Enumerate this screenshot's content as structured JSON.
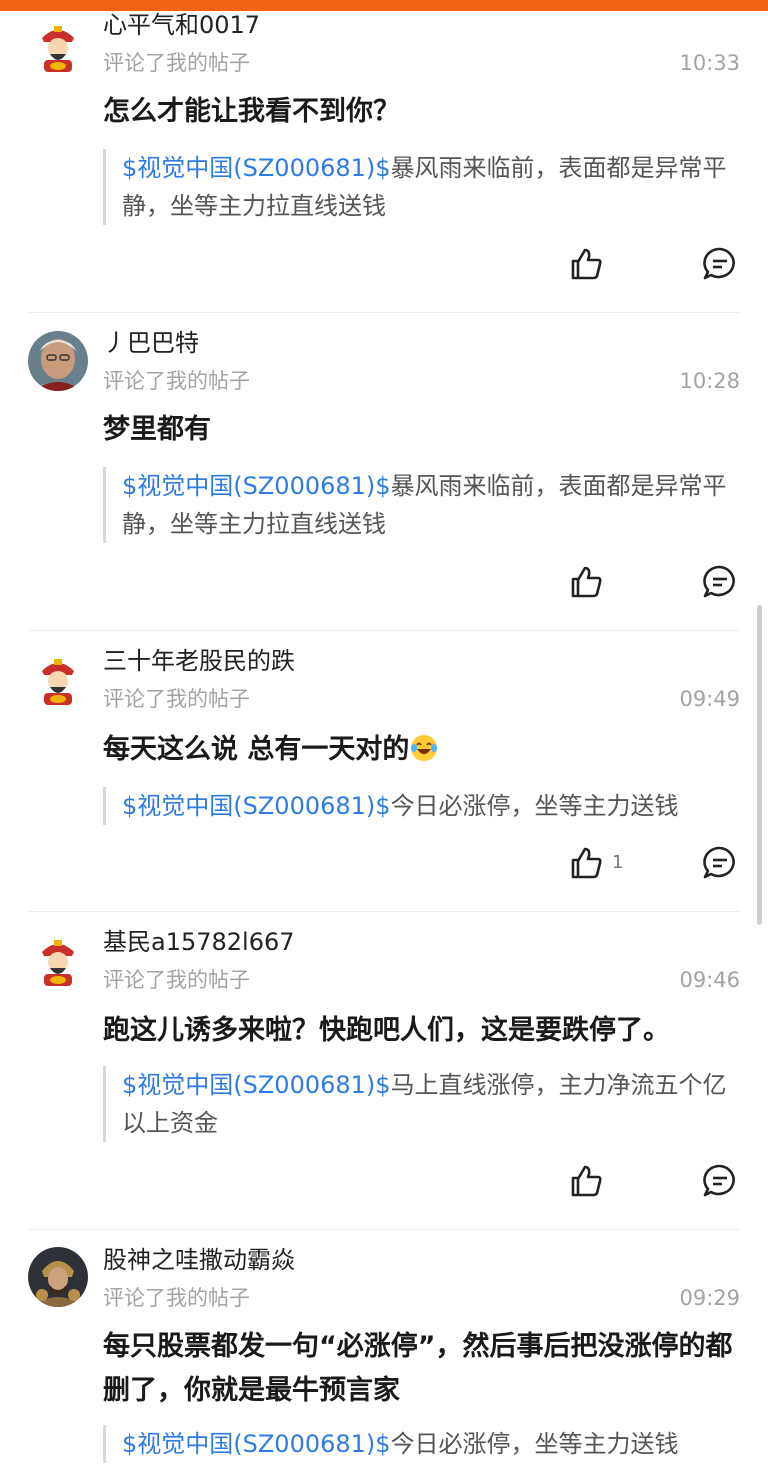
{
  "colors": {
    "accent": "#f26310",
    "link": "#2f7be5"
  },
  "posts": [
    {
      "username": "心平气和0017",
      "action": "评论了我的帖子",
      "time": "10:33",
      "content": "怎么才能让我看不到你？",
      "quote_stock": "$视觉中国(SZ000681)$",
      "quote_text": "暴风雨来临前，表面都是异常平静，坐等主力拉直线送钱",
      "likes": "",
      "avatar_icon": "god-of-wealth-icon"
    },
    {
      "username": "丿巴巴特",
      "action": "评论了我的帖子",
      "time": "10:28",
      "content": "梦里都有",
      "quote_stock": "$视觉中国(SZ000681)$",
      "quote_text": "暴风雨来临前，表面都是异常平静，坐等主力拉直线送钱",
      "likes": "",
      "avatar_icon": "elderly-man-photo"
    },
    {
      "username": "三十年老股民的跌",
      "action": "评论了我的帖子",
      "time": "09:49",
      "content": "每天这么说 总有一天对的",
      "content_emoji": "laughing-tears-emoji",
      "quote_stock": "$视觉中国(SZ000681)$",
      "quote_text": "今日必涨停，坐等主力送钱",
      "likes": "1",
      "avatar_icon": "god-of-wealth-icon"
    },
    {
      "username": "基民a15782l667",
      "action": "评论了我的帖子",
      "time": "09:46",
      "content": "跑这儿诱多来啦？快跑吧人们，这是要跌停了。",
      "quote_stock": "$视觉中国(SZ000681)$",
      "quote_text": "马上直线涨停，主力净流五个亿以上资金",
      "likes": "",
      "avatar_icon": "god-of-wealth-icon"
    },
    {
      "username": "股神之哇撒动霸焱",
      "action": "评论了我的帖子",
      "time": "09:29",
      "content": "每只股票都发一句“必涨停”，然后事后把没涨停的都删了，你就是最牛预言家",
      "quote_stock": "$视觉中国(SZ000681)$",
      "quote_text": "今日必涨停，坐等主力送钱",
      "likes": "",
      "avatar_icon": "warrior-portrait-photo"
    }
  ],
  "icons": {
    "like": "thumbs-up-icon",
    "reply": "comment-bubble-icon"
  }
}
